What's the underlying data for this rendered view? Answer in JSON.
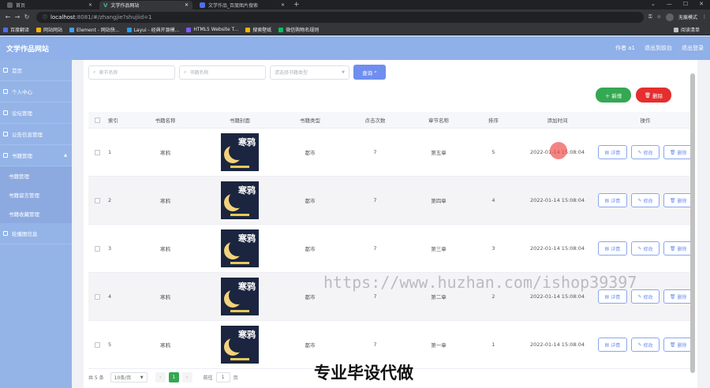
{
  "browser": {
    "tabs": [
      {
        "title": "首页",
        "active": false
      },
      {
        "title": "文学作品网站",
        "active": true
      },
      {
        "title": "文学作品_百度图片搜索",
        "active": false
      }
    ],
    "url_host": "localhost",
    "url_path": ":8081/#/zhangjie?shujiid=1",
    "profile_label": "无痕模式",
    "bookmarks": [
      "百度翻译",
      "网站网站",
      "Element - 网站快...",
      "Layui - 经典开源模...",
      "HTML5 Website T...",
      "搜索壁纸",
      "微信购物名规则"
    ],
    "reading_list": "阅读清单"
  },
  "app": {
    "title": "文学作品网站",
    "header_links": [
      "作者 a1",
      "退出到前台",
      "退出登录"
    ]
  },
  "sidebar": {
    "items": [
      {
        "label": "首页",
        "level": 1
      },
      {
        "label": "个人中心",
        "level": 1
      },
      {
        "label": "论坛管理",
        "level": 1
      },
      {
        "label": "公告信息管理",
        "level": 1
      },
      {
        "label": "书籍管理",
        "level": 1
      },
      {
        "label": "书籍管理",
        "level": 2
      },
      {
        "label": "书籍留言管理",
        "level": 2
      },
      {
        "label": "书籍收藏管理",
        "level": 2
      },
      {
        "label": "轮播图信息",
        "level": 1
      }
    ]
  },
  "search": {
    "chapter_placeholder": "章节名称",
    "book_placeholder": "书籍名称",
    "type_placeholder": "请选择书籍类型",
    "query_label": "查询"
  },
  "actions": {
    "add_label": "新增",
    "delete_label": "删除"
  },
  "table": {
    "headers": [
      "索引",
      "书籍名称",
      "书籍封面",
      "书籍类型",
      "点击次数",
      "章节名称",
      "排序",
      "添加时间",
      "操作"
    ],
    "cover_title": "寒鸦",
    "op_labels": [
      "详情",
      "修改",
      "删除"
    ],
    "rows": [
      {
        "idx": "1",
        "name": "寒鸦",
        "type": "都市",
        "clicks": "7",
        "chapter": "第五章",
        "sort": "5",
        "time": "2022-01-14 15:08:04"
      },
      {
        "idx": "2",
        "name": "寒鸦",
        "type": "都市",
        "clicks": "7",
        "chapter": "第四章",
        "sort": "4",
        "time": "2022-01-14 15:08:04"
      },
      {
        "idx": "3",
        "name": "寒鸦",
        "type": "都市",
        "clicks": "7",
        "chapter": "第三章",
        "sort": "3",
        "time": "2022-01-14 15:08:04"
      },
      {
        "idx": "4",
        "name": "寒鸦",
        "type": "都市",
        "clicks": "7",
        "chapter": "第二章",
        "sort": "2",
        "time": "2022-01-14 15:08:04"
      },
      {
        "idx": "5",
        "name": "寒鸦",
        "type": "都市",
        "clicks": "7",
        "chapter": "第一章",
        "sort": "1",
        "time": "2022-01-14 15:08:04"
      }
    ]
  },
  "pager": {
    "total": "共 5 条",
    "page_size": "10条/页",
    "current": "1",
    "goto_label": "前往",
    "goto_value": "1",
    "unit": "页"
  },
  "overlay": {
    "watermark": "https://www.huzhan.com/ishop39397",
    "caption": "专业毕设代做"
  },
  "colors": {
    "header": "#8fb0e8",
    "sidebar": "#94b4e8",
    "primary": "#6e8ef0",
    "success": "#34a853",
    "danger": "#e52e2e"
  }
}
